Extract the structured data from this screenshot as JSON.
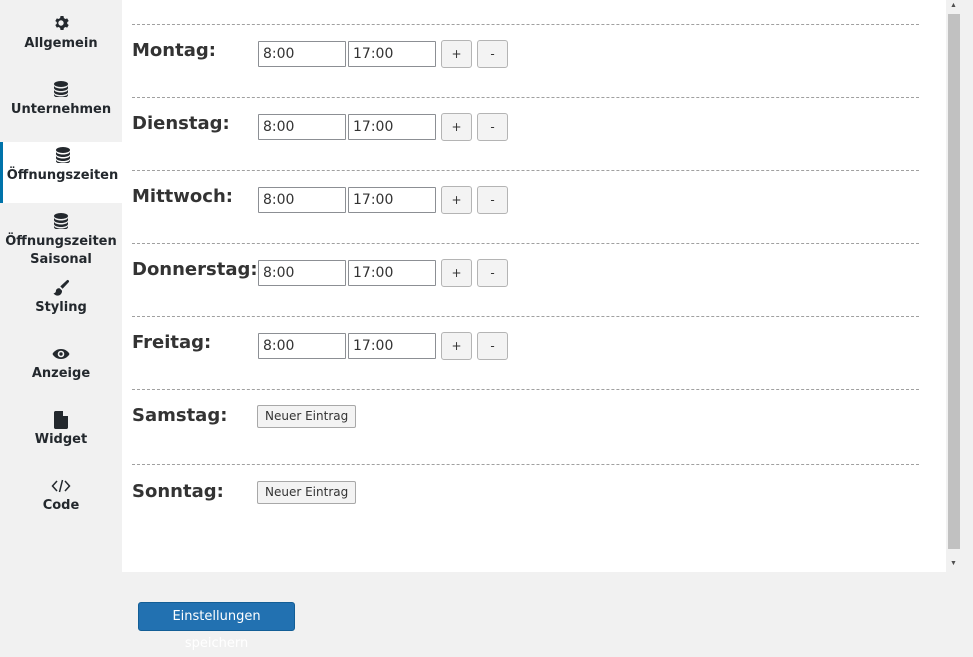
{
  "sidebar": {
    "items": [
      {
        "label": "Allgemein",
        "icon": "gear-icon"
      },
      {
        "label": "Unternehmen",
        "icon": "database-icon"
      },
      {
        "label": "Öffnungszeiten",
        "icon": "database-icon",
        "active": true
      },
      {
        "label": "Öffnungszeiten Saisonal",
        "icon": "database-icon"
      },
      {
        "label": "Styling",
        "icon": "brush-icon"
      },
      {
        "label": "Anzeige",
        "icon": "eye-icon"
      },
      {
        "label": "Widget",
        "icon": "file-icon"
      },
      {
        "label": "Code",
        "icon": "code-icon"
      }
    ]
  },
  "days": [
    {
      "label": "Montag:",
      "open": "8:00",
      "close": "17:00"
    },
    {
      "label": "Dienstag:",
      "open": "8:00",
      "close": "17:00"
    },
    {
      "label": "Mittwoch:",
      "open": "8:00",
      "close": "17:00"
    },
    {
      "label": "Donnerstag:",
      "open": "8:00",
      "close": "17:00"
    },
    {
      "label": "Freitag:",
      "open": "8:00",
      "close": "17:00"
    },
    {
      "label": "Samstag:",
      "new_entry": "Neuer Eintrag"
    },
    {
      "label": "Sonntag:",
      "new_entry": "Neuer Eintrag"
    }
  ],
  "buttons": {
    "plus": "+",
    "minus": "-"
  },
  "save_label": "Einstellungen speichern",
  "colors": {
    "accent": "#2271b1",
    "active_border": "#0073aa"
  }
}
